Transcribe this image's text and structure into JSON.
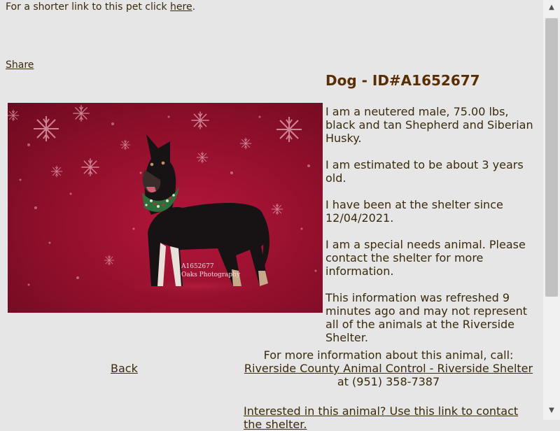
{
  "page": {
    "short_link_prefix": "For a shorter link to this pet click ",
    "short_link_text": "here",
    "short_link_suffix": ".",
    "share_text": "Share"
  },
  "pet": {
    "title": "Dog - ID#A1652677",
    "photo_watermark_id": "A1652677",
    "photo_watermark_studio": "Oaks Photography",
    "info": [
      "I am a neutered male, 75.00 lbs, black and tan Shepherd and Siberian Husky.",
      "I am estimated to be about 3 years old.",
      "I have been at the shelter since 12/04/2021.",
      "I am a special needs animal. Please contact the shelter for more information.",
      "This information was refreshed 9 minutes ago and may not represent all of the animals at the Riverside Shelter."
    ]
  },
  "contact": {
    "intro": "For more information about this animal, call:",
    "shelter_link": "Riverside County Animal Control - Riverside Shelter",
    "phone_prefix": " at ",
    "phone": "(951) 358-7387"
  },
  "nav": {
    "back": "Back",
    "interested": "Interested in this animal? Use this link to contact the shelter."
  },
  "scrollbar": {
    "up_icon": "triangle-up",
    "down_icon": "triangle-down"
  },
  "colors": {
    "background": "#e6e6e6",
    "text": "#3a2a0c",
    "title": "#5a2e05",
    "photo_backdrop": "#9b1230"
  }
}
